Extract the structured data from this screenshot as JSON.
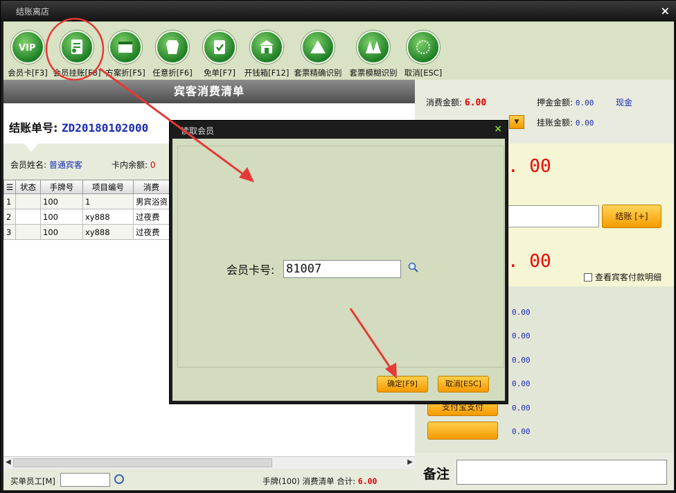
{
  "window": {
    "title": "结账离店",
    "close": "×"
  },
  "toolbar": {
    "items": [
      {
        "label": "会员卡[F3]",
        "icon": "vip-card-icon"
      },
      {
        "label": "会员挂账[F8]",
        "icon": "member-charge-icon"
      },
      {
        "label": "方案折[F5]",
        "icon": "plan-discount-icon"
      },
      {
        "label": "任意折[F6]",
        "icon": "any-discount-icon"
      },
      {
        "label": "免单[F7]",
        "icon": "free-order-icon"
      },
      {
        "label": "开钱箱[F12]",
        "icon": "cash-drawer-icon"
      },
      {
        "label": "套票精确识别",
        "icon": "package-exact-icon"
      },
      {
        "label": "套票模糊识别",
        "icon": "package-fuzzy-icon"
      },
      {
        "label": "取消[ESC]",
        "icon": "cancel-icon"
      }
    ]
  },
  "bill": {
    "header": "宾客消费清单",
    "number_label": "结账单号:",
    "number": "ZD20180102000",
    "member_name_label": "会员姓名:",
    "member_name": "普通宾客",
    "balance_label": "卡内余额:",
    "balance": "0",
    "columns": [
      "状态",
      "手牌号",
      "项目编号",
      "消费"
    ],
    "rows": [
      {
        "idx": "1",
        "status": "",
        "tag": "100",
        "code": "1",
        "item": "男宾浴资"
      },
      {
        "idx": "2",
        "status": "",
        "tag": "100",
        "code": "xy888",
        "item": "过夜费"
      },
      {
        "idx": "3",
        "status": "",
        "tag": "100",
        "code": "xy888",
        "item": "过夜费"
      }
    ],
    "staff_label": "买单员工[M]",
    "footer_text": "手牌(100) 消费清单 合计:",
    "footer_total": "6.00"
  },
  "summary": {
    "consume_label": "消费金额:",
    "consume": "6.00",
    "deposit_label": "押金金额:",
    "deposit": "0.00",
    "cash_label": "现金",
    "hang_label": "挂账金额:",
    "hang": "0.00",
    "partial_label": "...",
    "big1": ". 00",
    "big2": ". 00",
    "pay_button": "结账 [+]",
    "detail_check": "查看宾客付款明细",
    "amounts": [
      "0.00",
      "0.00",
      "0.00",
      "0.00",
      "0.00",
      "0.00"
    ],
    "alipay_button": "支付宝支付",
    "remark_label": "备注"
  },
  "dialog": {
    "title": "读取会员",
    "close": "×",
    "card_label": "会员卡号:",
    "card_value": "81007",
    "ok_button": "确定[F9]",
    "cancel_button": "取消[ESC]"
  },
  "colors": {
    "accent": "#f59a00",
    "highlight_red": "#e53935",
    "toolbar_bg": "#d9e2c4"
  }
}
